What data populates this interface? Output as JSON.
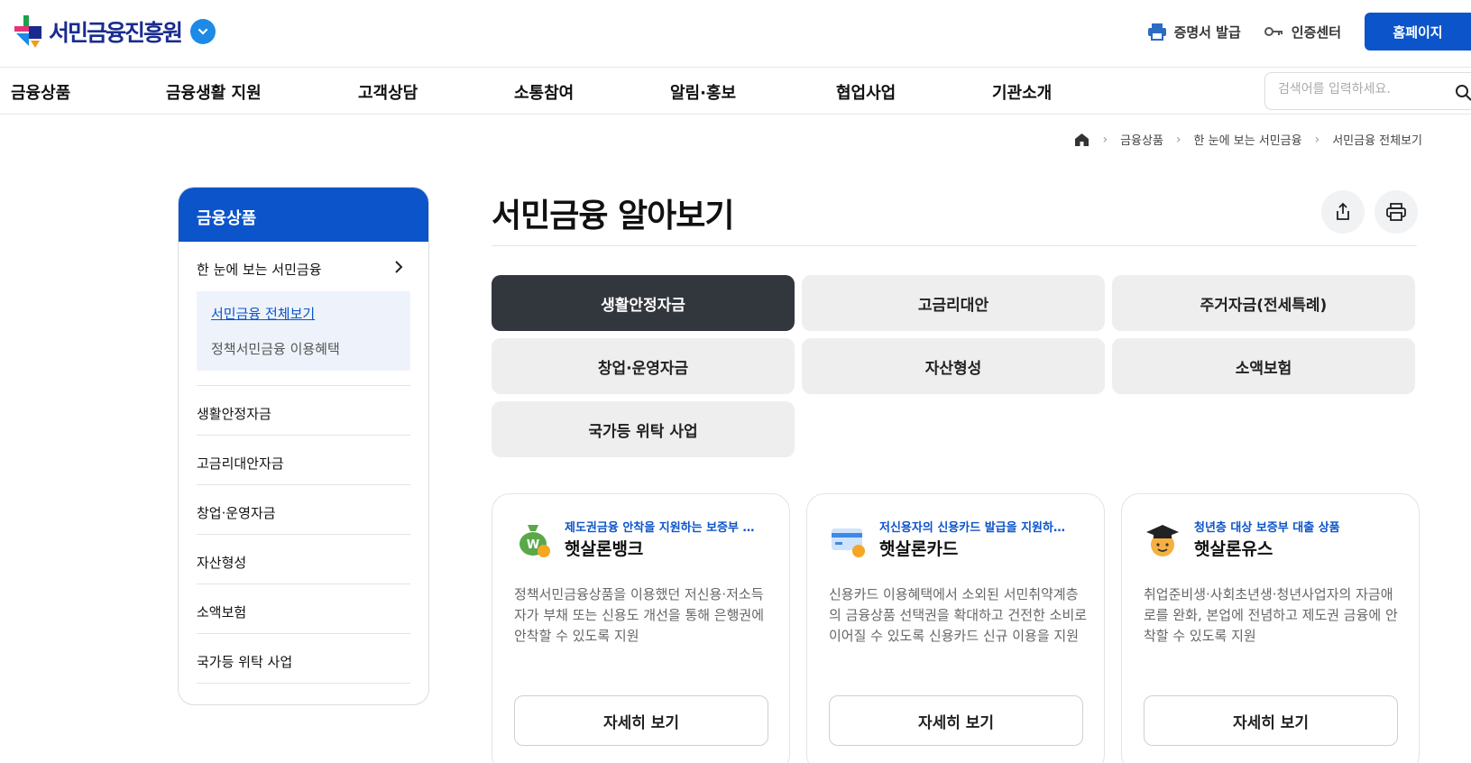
{
  "header": {
    "logo_text": "서민금융진흥원",
    "utils": [
      {
        "label": "증명서 발급",
        "icon": "printer-icon"
      },
      {
        "label": "인증센터",
        "icon": "key-icon"
      }
    ],
    "home_button": "홈페이지"
  },
  "nav": {
    "items": [
      "금융상품",
      "금융생활 지원",
      "고객상담",
      "소통참여",
      "알림·홍보",
      "협업사업",
      "기관소개"
    ],
    "search_placeholder": "검색어를 입력하세요."
  },
  "breadcrumb": [
    "금융상품",
    "한 눈에 보는 서민금융",
    "서민금융 전체보기"
  ],
  "sidebar": {
    "title": "금융상품",
    "group": "한 눈에 보는 서민금융",
    "sub_items": [
      "서민금융 전체보기",
      "정책서민금융 이용혜택"
    ],
    "items": [
      "생활안정자금",
      "고금리대안자금",
      "창업·운영자금",
      "자산형성",
      "소액보험",
      "국가등 위탁 사업"
    ]
  },
  "main": {
    "title": "서민금융 알아보기",
    "tabs": [
      "생활안정자금",
      "고금리대안",
      "주거자금(전세특례)",
      "창업·운영자금",
      "자산형성",
      "소액보험",
      "국가등 위탁 사업"
    ],
    "active_tab": "생활안정자금"
  },
  "cards": [
    {
      "tag": "제도권금융 안착을 지원하는 보증부 …",
      "name": "햇살론뱅크",
      "icon": "money-bag-icon",
      "desc": "정책서민금융상품을 이용했던 저신용·저소득자가 부채 또는 신용도 개선을 통해 은행권에 안착할 수 있도록 지원",
      "button": "자세히 보기"
    },
    {
      "tag": "저신용자의 신용카드 발급을 지원하…",
      "name": "햇살론카드",
      "icon": "credit-card-icon",
      "desc": "신용카드 이용혜택에서 소외된 서민취약계층의 금융상품 선택권을 확대하고 건전한 소비로 이어질 수 있도록 신용카드 신규 이용을 지원",
      "button": "자세히 보기"
    },
    {
      "tag": "청년층 대상 보증부 대출 상품",
      "name": "햇살론유스",
      "icon": "graduate-icon",
      "desc": "취업준비생·사회초년생·청년사업자의 자금애로를 완화, 본업에 전념하고 제도권 금융에 안착할 수 있도록 지원",
      "button": "자세히 보기"
    }
  ],
  "colors": {
    "primary": "#0c54c9",
    "tab_active": "#32363d",
    "tab_inactive": "#eeeeee",
    "logo_text": "#1a2b8f",
    "logo_chevron": "#1c8ae6"
  }
}
